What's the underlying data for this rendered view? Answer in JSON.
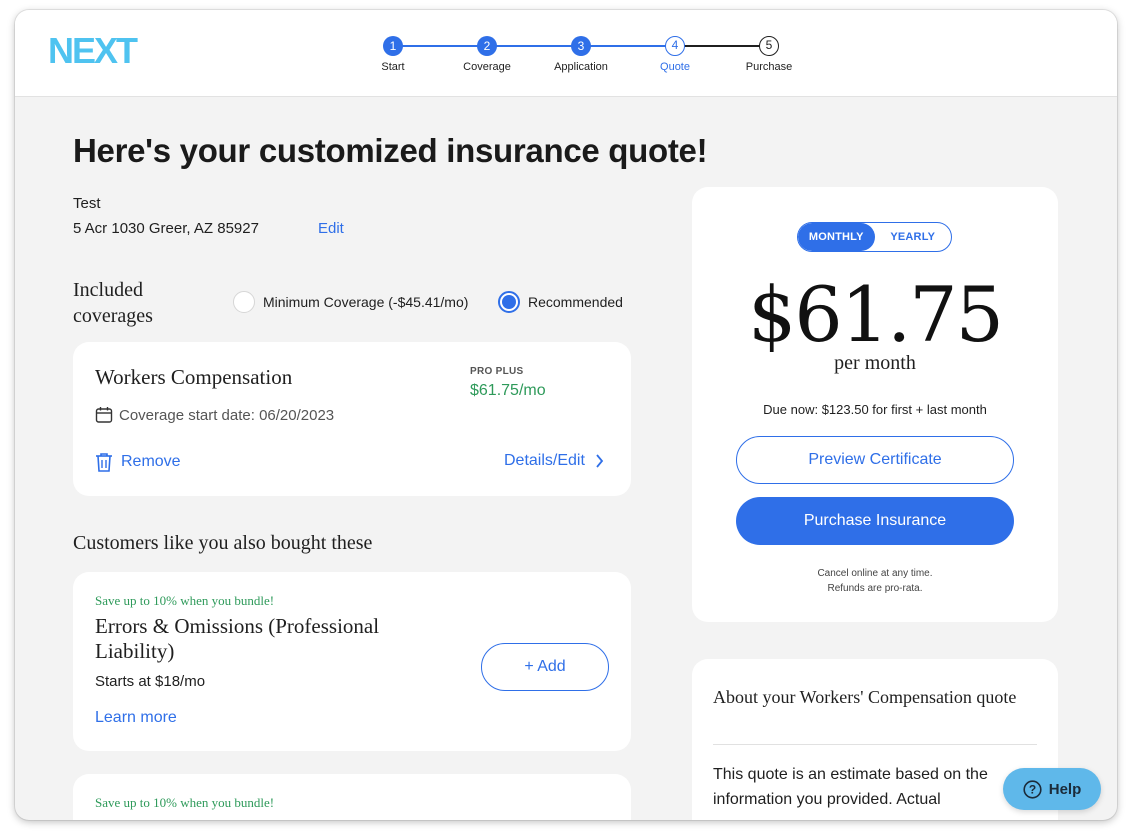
{
  "brand": {
    "logo_text": "NEXT",
    "color": "#4fc3f0"
  },
  "stepper": {
    "steps": [
      {
        "num": "1",
        "label": "Start",
        "state": "done"
      },
      {
        "num": "2",
        "label": "Coverage",
        "state": "done"
      },
      {
        "num": "3",
        "label": "Application",
        "state": "done"
      },
      {
        "num": "4",
        "label": "Quote",
        "state": "current"
      },
      {
        "num": "5",
        "label": "Purchase",
        "state": "future"
      }
    ]
  },
  "page": {
    "title": "Here's your customized insurance quote!",
    "business_name": "Test",
    "address": "5 Acr 1030 Greer, AZ 85927",
    "edit_label": "Edit"
  },
  "coverage": {
    "title": "Included coverages",
    "options": [
      {
        "label": "Minimum Coverage (-$45.41/mo)",
        "selected": false
      },
      {
        "label": "Recommended",
        "selected": true
      }
    ]
  },
  "policy_card": {
    "title": "Workers Compensation",
    "tier": "PRO PLUS",
    "price": "$61.75/mo",
    "start_date": "Coverage start date: 06/20/2023",
    "remove_label": "Remove",
    "details_label": "Details/Edit"
  },
  "upsell": {
    "title": "Customers like you also bought these",
    "items": [
      {
        "bundle_note": "Save up to 10% when you bundle!",
        "title": "Errors & Omissions (Professional Liability)",
        "starts_at": "Starts at $18/mo",
        "learn_more": "Learn more",
        "add_label": "+ Add"
      },
      {
        "bundle_note": "Save up to 10% when you bundle!"
      }
    ]
  },
  "pricing": {
    "toggle": {
      "monthly": "MONTHLY",
      "yearly": "YEARLY",
      "selected": "monthly"
    },
    "amount": "$61.75",
    "period": "per month",
    "due_now": "Due now: $123.50 for first + last month",
    "preview_label": "Preview Certificate",
    "purchase_label": "Purchase Insurance",
    "cancel_line1": "Cancel online at any time.",
    "cancel_line2": "Refunds are pro-rata."
  },
  "about": {
    "title": "About your Workers' Compensation quote",
    "body": "This quote is an estimate based on the information you provided. Actual"
  },
  "help": {
    "label": "Help"
  },
  "colors": {
    "accent": "#2f6fe8",
    "green": "#2e9a5a",
    "help_bg": "#5fb8ea"
  }
}
